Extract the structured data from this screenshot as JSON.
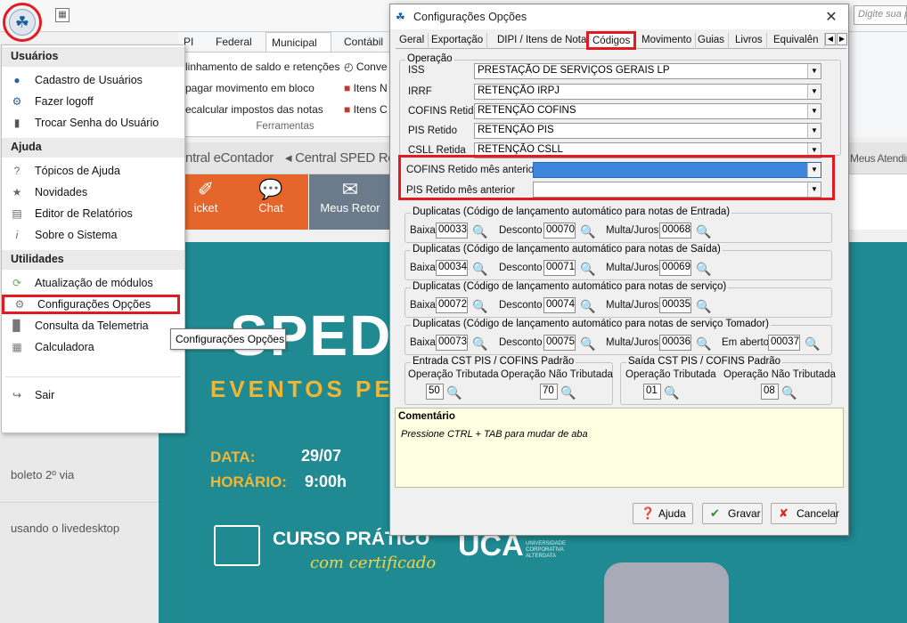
{
  "topbar": {
    "search_placeholder": "Digite sua p"
  },
  "ribbon": {
    "tabs": [
      "PI",
      "Federal",
      "Municipal",
      "Contábil"
    ],
    "active_tab": "Municipal",
    "items": [
      "linhamento de saldo e retenções",
      "pagar movimento em bloco",
      "ecalcular impostos das notas"
    ],
    "items_right": [
      "Conve",
      "Itens N",
      "Itens C"
    ],
    "group_label": "Ferramentas"
  },
  "tabsbar": {
    "items": [
      "entral eContador",
      "Central SPED Rei",
      "Meus Atendin"
    ]
  },
  "tiles": {
    "ticket": "icket",
    "chat": "Chat",
    "retornos": "Meus Retor"
  },
  "banner": {
    "big": "SPED",
    "sub": "EVENTOS PE",
    "date_label": "DATA:",
    "date_value": "29/07",
    "time_label": "HORÁRIO:",
    "time_value": "9:00h",
    "course_line1": "CURSO PRÁTICO",
    "course_line2": "com certificado",
    "uca": "UCA",
    "uca_sub": "UNIVERSIDADE CORPORATIVA ALTERDATA"
  },
  "leftpanel": {
    "items": [
      "boleto 2º via",
      "usando o livedesktop"
    ]
  },
  "menu": {
    "sections": [
      {
        "title": "Usuários",
        "items": [
          {
            "label": "Cadastro de Usuários",
            "icon": "user-icon"
          },
          {
            "label": "Fazer logoff",
            "icon": "logoff-icon"
          },
          {
            "label": "Trocar Senha do Usuário",
            "icon": "lock-icon"
          }
        ]
      },
      {
        "title": "Ajuda",
        "items": [
          {
            "label": "Tópicos de Ajuda",
            "icon": "help-icon"
          },
          {
            "label": "Novidades",
            "icon": "star-icon"
          },
          {
            "label": "Editor de Relatórios",
            "icon": "report-icon"
          },
          {
            "label": "Sobre o Sistema",
            "icon": "info-icon"
          }
        ]
      },
      {
        "title": "Utilidades",
        "items": [
          {
            "label": "Atualização de módulos",
            "icon": "refresh-icon"
          },
          {
            "label": "Configurações Opções",
            "icon": "gear-icon"
          },
          {
            "label": "Consulta da Telemetria",
            "icon": "chart-icon"
          },
          {
            "label": "Calculadora",
            "icon": "calculator-icon"
          }
        ]
      }
    ],
    "exit": "Sair",
    "tooltip": "Configurações Opções"
  },
  "dialog": {
    "title": "Configurações Opções",
    "tabs": [
      "Geral",
      "Exportação",
      "DIPI / Itens de Nota",
      "Códigos",
      "Movimento",
      "Guias",
      "Livros",
      "Equivalên"
    ],
    "active_tab": "Códigos",
    "operacao_label": "Operação",
    "fields": [
      {
        "label": "ISS",
        "value": "PRESTAÇÃO DE SERVIÇOS GERAIS LP"
      },
      {
        "label": "IRRF",
        "value": "RETENÇÃO IRPJ"
      },
      {
        "label": "COFINS Retido",
        "value": "RETENÇÃO COFINS"
      },
      {
        "label": "PIS Retido",
        "value": "RETENÇÃO PIS"
      },
      {
        "label": "CSLL Retida",
        "value": "RETENÇÃO CSLL"
      },
      {
        "label": "COFINS Retido mês anterior",
        "value": ""
      },
      {
        "label": "PIS Retido mês anterior",
        "value": ""
      }
    ],
    "dup_groups": [
      {
        "title": "Duplicatas (Código de  lançamento automático para notas de Entrada)",
        "baixa": "00033",
        "desconto": "00070",
        "multa": "00068"
      },
      {
        "title": "Duplicatas (Código de  lançamento automático para notas de Saída)",
        "baixa": "00034",
        "desconto": "00071",
        "multa": "00069"
      },
      {
        "title": "Duplicatas (Código de  lançamento automático para notas de serviço)",
        "baixa": "00072",
        "desconto": "00074",
        "multa": "00035"
      },
      {
        "title": "Duplicatas (Código de  lançamento automático para notas de serviço Tomador)",
        "baixa": "00073",
        "desconto": "00075",
        "multa": "00036",
        "aberto": "00037"
      }
    ],
    "labels": {
      "baixa": "Baixa",
      "desconto": "Desconto",
      "multa": "Multa/Juros",
      "aberto": "Em aberto"
    },
    "cst_entrada": {
      "title": "Entrada CST PIS / COFINS Padrão",
      "op_trib": "Operação Tributada",
      "op_nao_trib": "Operação Não Tributada",
      "trib_value": "50",
      "nao_trib_value": "70"
    },
    "cst_saida": {
      "title": "Saída CST PIS / COFINS Padrão",
      "op_trib": "Operação Tributada",
      "op_nao_trib": "Operação Não Tributada",
      "trib_value": "01",
      "nao_trib_value": "08"
    },
    "comment_title": "Comentário",
    "comment_text": "Pressione CTRL + TAB para  mudar de aba",
    "buttons": {
      "help": "Ajuda",
      "save": "Gravar",
      "cancel": "Cancelar"
    }
  }
}
